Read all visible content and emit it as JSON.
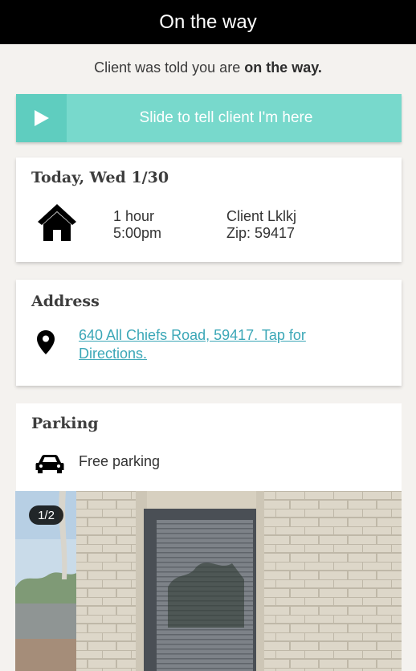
{
  "header": {
    "title": "On the way"
  },
  "status": {
    "prefix": "Client was told you are ",
    "emphasis": "on the way."
  },
  "slider": {
    "label": "Slide to tell client I'm here",
    "handle_icon": "play-icon"
  },
  "appointment": {
    "date": "Today, Wed 1/30",
    "icon": "home-icon",
    "duration": "1 hour",
    "time": "5:00pm",
    "client": "Client Lklkj",
    "zip": "Zip: 59417"
  },
  "address": {
    "title": "Address",
    "icon": "map-pin-icon",
    "link_line1": "640 All Chiefs Road, 59417. Tap for",
    "link_line2": "Directions."
  },
  "parking": {
    "title": "Parking",
    "icon": "car-icon",
    "text": "Free parking"
  },
  "photo": {
    "counter": "1/2"
  },
  "colors": {
    "accent": "#78d9cc",
    "accent_dark": "#5fcdbf",
    "link": "#3ba7b7",
    "header_bg": "#000000"
  }
}
